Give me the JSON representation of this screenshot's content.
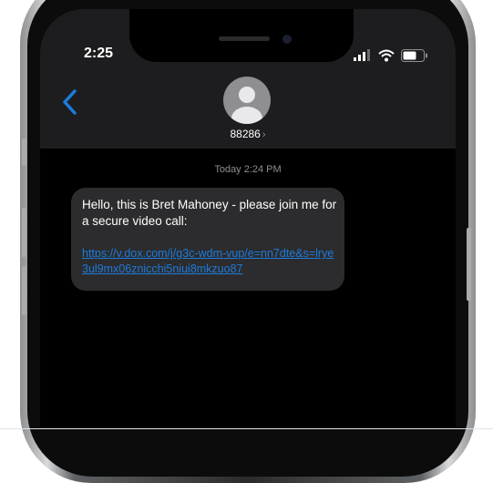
{
  "status_bar": {
    "time": "2:25",
    "icons": [
      "cellular-signal-icon",
      "wifi-icon",
      "battery-icon"
    ]
  },
  "header": {
    "back_icon": "chevron-left-icon",
    "avatar_icon": "person-silhouette-icon",
    "contact_name": "88286",
    "contact_chevron": "›"
  },
  "conversation": {
    "timestamp": "Today 2:24 PM",
    "messages": [
      {
        "text": "Hello, this is Bret Mahoney - please join me for a secure video call:",
        "link": "https://v.dox.com/j/g3c-wdm-vup/e=nn7dte&s=lrye3ul9mx06znicchi5niui8mkzuo87"
      }
    ]
  },
  "colors": {
    "accent": "#1d7bdb",
    "bubble": "#2c2c2e",
    "header_bg": "#1d1d1f",
    "screen_bg": "#000000"
  }
}
